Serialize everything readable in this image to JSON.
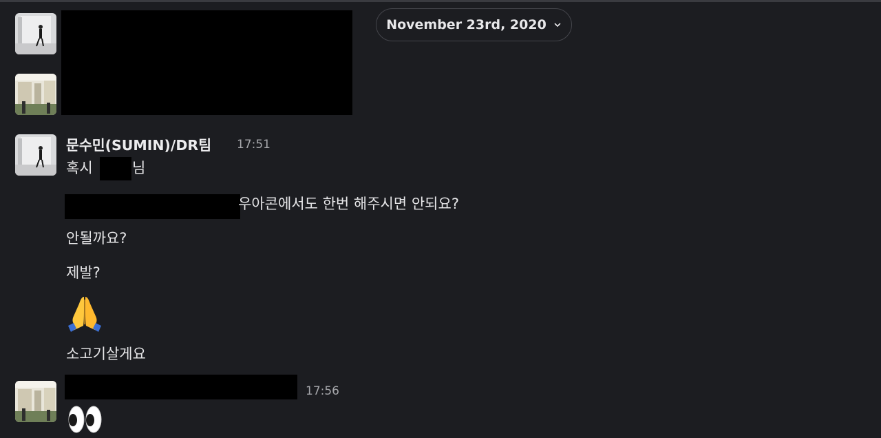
{
  "date_divider": {
    "label": "November 23rd, 2020",
    "icon": "chevron-down-icon"
  },
  "messages": {
    "sumin": {
      "sender": "문수민(SUMIN)/DR팀",
      "time": "17:51",
      "line1_prefix": "혹시 ",
      "line1_suffix": "님",
      "line2_suffix": " 우아콘에서도 한번 해주시면 안되요?",
      "line3": "안될까요?",
      "line4": "제발?",
      "line5_emoji": "folded-hands-emoji",
      "line6": "소고기살게요"
    },
    "reply": {
      "time": "17:56",
      "emoji": "eyes-emoji"
    }
  },
  "colors": {
    "background": "#1c1d21",
    "text": "#e6e6e8",
    "muted": "#a6a7ab",
    "redaction": "#000000"
  }
}
